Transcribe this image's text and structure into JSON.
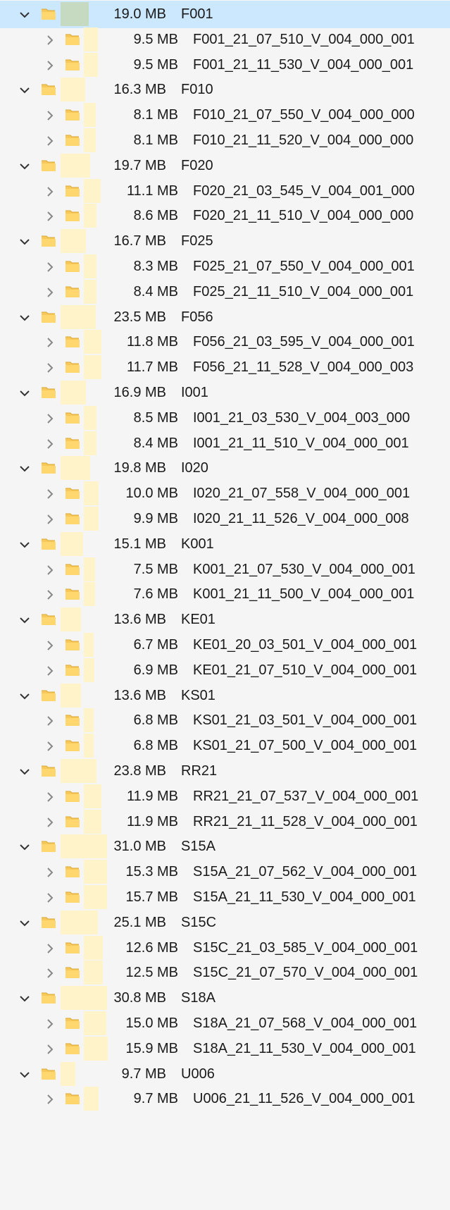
{
  "colors": {
    "selection": "#cce8ff",
    "bar": "#fff3c9",
    "bar_selected": "#c6dac2",
    "folder": "#f8c95a"
  },
  "icons": {
    "expanded": "chevron-down-icon",
    "collapsed": "chevron-right-icon",
    "folder": "folder-icon"
  },
  "rows": [
    {
      "level": 0,
      "expanded": true,
      "selected": true,
      "size": "19.0 MB",
      "name": "F001",
      "ratio": 0.613
    },
    {
      "level": 1,
      "expanded": false,
      "size": "9.5 MB",
      "name": "F001_21_07_510_V_004_000_001",
      "ratio": 0.306
    },
    {
      "level": 1,
      "expanded": false,
      "size": "9.5 MB",
      "name": "F001_21_11_530_V_004_000_001",
      "ratio": 0.306
    },
    {
      "level": 0,
      "expanded": true,
      "size": "16.3 MB",
      "name": "F010",
      "ratio": 0.526
    },
    {
      "level": 1,
      "expanded": false,
      "size": "8.1 MB",
      "name": "F010_21_07_550_V_004_000_000",
      "ratio": 0.261
    },
    {
      "level": 1,
      "expanded": false,
      "size": "8.1 MB",
      "name": "F010_21_11_520_V_004_000_000",
      "ratio": 0.261
    },
    {
      "level": 0,
      "expanded": true,
      "size": "19.7 MB",
      "name": "F020",
      "ratio": 0.635
    },
    {
      "level": 1,
      "expanded": false,
      "size": "11.1 MB",
      "name": "F020_21_03_545_V_004_001_000",
      "ratio": 0.358
    },
    {
      "level": 1,
      "expanded": false,
      "size": "8.6 MB",
      "name": "F020_21_11_510_V_004_000_000",
      "ratio": 0.277
    },
    {
      "level": 0,
      "expanded": true,
      "size": "16.7 MB",
      "name": "F025",
      "ratio": 0.539
    },
    {
      "level": 1,
      "expanded": false,
      "size": "8.3 MB",
      "name": "F025_21_07_550_V_004_000_001",
      "ratio": 0.268
    },
    {
      "level": 1,
      "expanded": false,
      "size": "8.4 MB",
      "name": "F025_21_11_510_V_004_000_001",
      "ratio": 0.271
    },
    {
      "level": 0,
      "expanded": true,
      "size": "23.5 MB",
      "name": "F056",
      "ratio": 0.758
    },
    {
      "level": 1,
      "expanded": false,
      "size": "11.8 MB",
      "name": "F056_21_03_595_V_004_000_001",
      "ratio": 0.381
    },
    {
      "level": 1,
      "expanded": false,
      "size": "11.7 MB",
      "name": "F056_21_11_528_V_004_000_003",
      "ratio": 0.377
    },
    {
      "level": 0,
      "expanded": true,
      "size": "16.9 MB",
      "name": "I001",
      "ratio": 0.545
    },
    {
      "level": 1,
      "expanded": false,
      "size": "8.5 MB",
      "name": "I001_21_03_530_V_004_003_000",
      "ratio": 0.274
    },
    {
      "level": 1,
      "expanded": false,
      "size": "8.4 MB",
      "name": "I001_21_11_510_V_004_000_001",
      "ratio": 0.271
    },
    {
      "level": 0,
      "expanded": true,
      "size": "19.8 MB",
      "name": "I020",
      "ratio": 0.639
    },
    {
      "level": 1,
      "expanded": false,
      "size": "10.0 MB",
      "name": "I020_21_07_558_V_004_000_001",
      "ratio": 0.323
    },
    {
      "level": 1,
      "expanded": false,
      "size": "9.9 MB",
      "name": "I020_21_11_526_V_004_000_008",
      "ratio": 0.319
    },
    {
      "level": 0,
      "expanded": true,
      "size": "15.1 MB",
      "name": "K001",
      "ratio": 0.487
    },
    {
      "level": 1,
      "expanded": false,
      "size": "7.5 MB",
      "name": "K001_21_07_530_V_004_000_001",
      "ratio": 0.242
    },
    {
      "level": 1,
      "expanded": false,
      "size": "7.6 MB",
      "name": "K001_21_11_500_V_004_000_001",
      "ratio": 0.245
    },
    {
      "level": 0,
      "expanded": true,
      "size": "13.6 MB",
      "name": "KE01",
      "ratio": 0.439
    },
    {
      "level": 1,
      "expanded": false,
      "size": "6.7 MB",
      "name": "KE01_20_03_501_V_004_000_001",
      "ratio": 0.216
    },
    {
      "level": 1,
      "expanded": false,
      "size": "6.9 MB",
      "name": "KE01_21_07_510_V_004_000_001",
      "ratio": 0.223
    },
    {
      "level": 0,
      "expanded": true,
      "size": "13.6 MB",
      "name": "KS01",
      "ratio": 0.439
    },
    {
      "level": 1,
      "expanded": false,
      "size": "6.8 MB",
      "name": "KS01_21_03_501_V_004_000_001",
      "ratio": 0.219
    },
    {
      "level": 1,
      "expanded": false,
      "size": "6.8 MB",
      "name": "KS01_21_07_500_V_004_000_001",
      "ratio": 0.219
    },
    {
      "level": 0,
      "expanded": true,
      "size": "23.8 MB",
      "name": "RR21",
      "ratio": 0.768
    },
    {
      "level": 1,
      "expanded": false,
      "size": "11.9 MB",
      "name": "RR21_21_07_537_V_004_000_001",
      "ratio": 0.384
    },
    {
      "level": 1,
      "expanded": false,
      "size": "11.9 MB",
      "name": "RR21_21_11_528_V_004_000_001",
      "ratio": 0.384
    },
    {
      "level": 0,
      "expanded": true,
      "size": "31.0 MB",
      "name": "S15A",
      "ratio": 1.0
    },
    {
      "level": 1,
      "expanded": false,
      "size": "15.3 MB",
      "name": "S15A_21_07_562_V_004_000_001",
      "ratio": 0.494
    },
    {
      "level": 1,
      "expanded": false,
      "size": "15.7 MB",
      "name": "S15A_21_11_530_V_004_000_001",
      "ratio": 0.506
    },
    {
      "level": 0,
      "expanded": true,
      "size": "25.1 MB",
      "name": "S15C",
      "ratio": 0.81
    },
    {
      "level": 1,
      "expanded": false,
      "size": "12.6 MB",
      "name": "S15C_21_03_585_V_004_000_001",
      "ratio": 0.406
    },
    {
      "level": 1,
      "expanded": false,
      "size": "12.5 MB",
      "name": "S15C_21_07_570_V_004_000_001",
      "ratio": 0.403
    },
    {
      "level": 0,
      "expanded": true,
      "size": "30.8 MB",
      "name": "S18A",
      "ratio": 0.994
    },
    {
      "level": 1,
      "expanded": false,
      "size": "15.0 MB",
      "name": "S18A_21_07_568_V_004_000_001",
      "ratio": 0.484
    },
    {
      "level": 1,
      "expanded": false,
      "size": "15.9 MB",
      "name": "S18A_21_11_530_V_004_000_001",
      "ratio": 0.513
    },
    {
      "level": 0,
      "expanded": true,
      "size": "9.7 MB",
      "name": "U006",
      "ratio": 0.313
    },
    {
      "level": 1,
      "expanded": false,
      "size": "9.7 MB",
      "name": "U006_21_11_526_V_004_000_001",
      "ratio": 0.313
    }
  ]
}
